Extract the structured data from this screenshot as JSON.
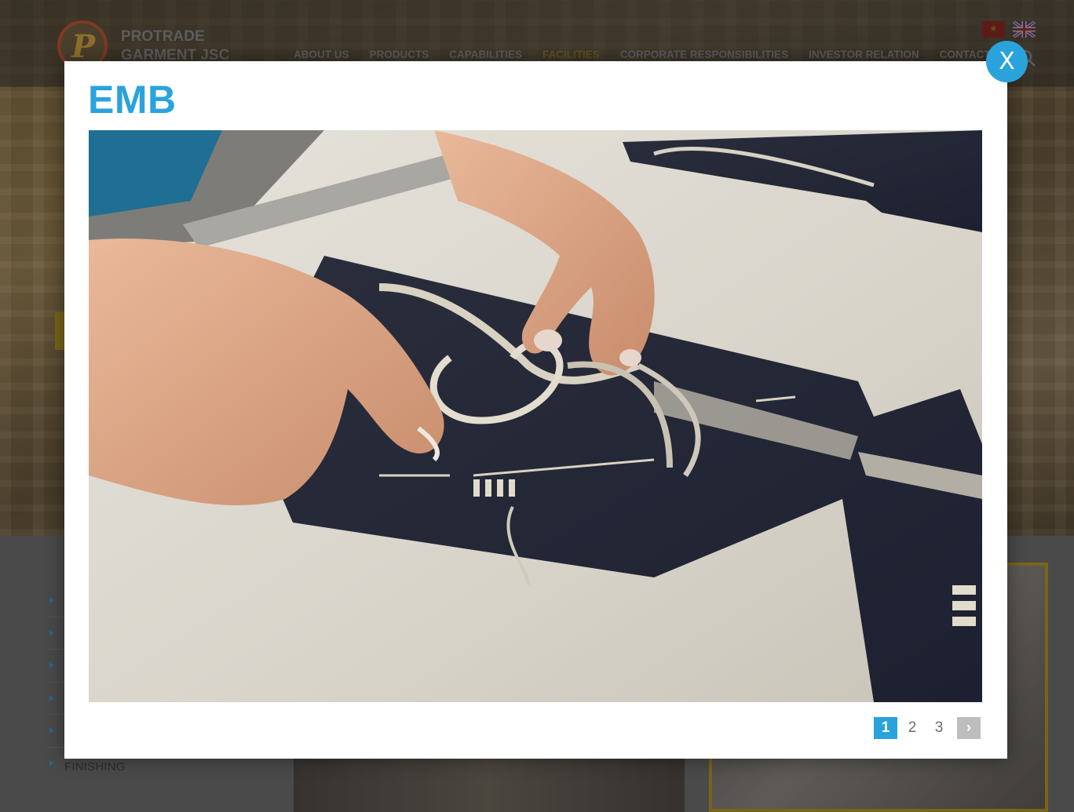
{
  "header": {
    "brand_line1": "PROTRADE",
    "brand_line2": "GARMENT JSC",
    "nav": [
      "ABOUT US",
      "PRODUCTS",
      "CAPABILITIES",
      "FACILITIES",
      "CORPORATE RESPONSIBILITIES",
      "INVESTOR RELATION",
      "CONTACT"
    ],
    "active_nav": "FACILITIES"
  },
  "sidebar": {
    "items": [
      "",
      "",
      "",
      "",
      "",
      "FINISHING"
    ]
  },
  "modal": {
    "title": "EMB",
    "close_label": "X",
    "image_icon": "embroidery-photo",
    "pagination": {
      "pages": [
        "1",
        "2",
        "3"
      ],
      "current": "1",
      "next_label": "›"
    }
  },
  "colors": {
    "accent": "#2aa3dc",
    "gold": "#b6961e"
  }
}
